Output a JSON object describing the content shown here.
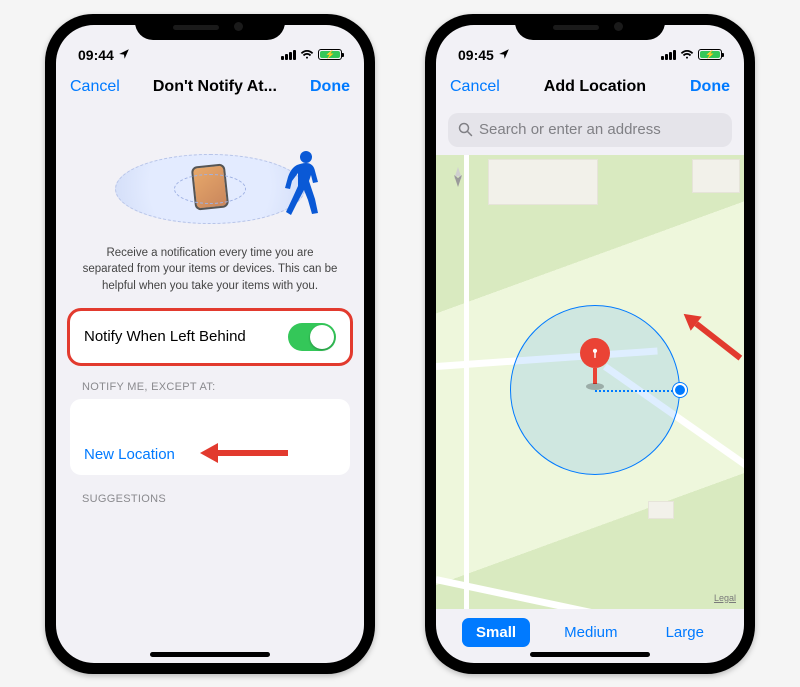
{
  "screen1": {
    "status": {
      "time": "09:44"
    },
    "nav": {
      "cancel": "Cancel",
      "title": "Don't Notify At...",
      "done": "Done"
    },
    "description": "Receive a notification every time you are separated from your items or devices. This can be helpful when you take your items with you.",
    "toggle_label": "Notify When Left Behind",
    "section_except": "NOTIFY ME, EXCEPT AT:",
    "new_location": "New Location",
    "section_suggestions": "SUGGESTIONS"
  },
  "screen2": {
    "status": {
      "time": "09:45"
    },
    "nav": {
      "cancel": "Cancel",
      "title": "Add Location",
      "done": "Done"
    },
    "search_placeholder": "Search or enter an address",
    "map_legal": "Legal",
    "sizes": {
      "small": "Small",
      "medium": "Medium",
      "large": "Large"
    }
  }
}
